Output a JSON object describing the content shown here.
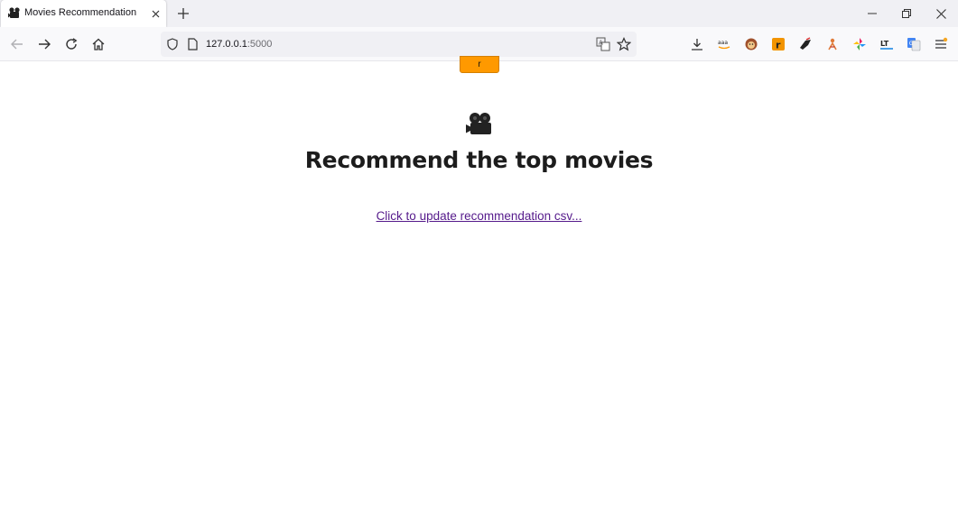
{
  "tab": {
    "title": "Movies Recommendation",
    "favicon": "movie-camera-icon"
  },
  "address_bar": {
    "host": "127.0.0.1",
    "port": ":5000"
  },
  "toolbar_extensions": [
    "download-icon",
    "amazon-assistant-icon",
    "monkey-extension-icon",
    "r-extension-icon",
    "hand-extension-icon",
    "person-extension-icon",
    "pinwheel-extension-icon",
    "lt-extension-icon",
    "translate-extension-icon",
    "menu-icon"
  ],
  "page": {
    "top_button_label": "r",
    "heading": "Recommend the top movies",
    "update_link": "Click to update recommendation csv...",
    "icon": "movie-camera-icon"
  },
  "colors": {
    "accent_button": "#ff9900",
    "visited_link": "#551a8b",
    "heading": "#1c1c1c",
    "tabstrip_bg": "#f0f0f4"
  }
}
